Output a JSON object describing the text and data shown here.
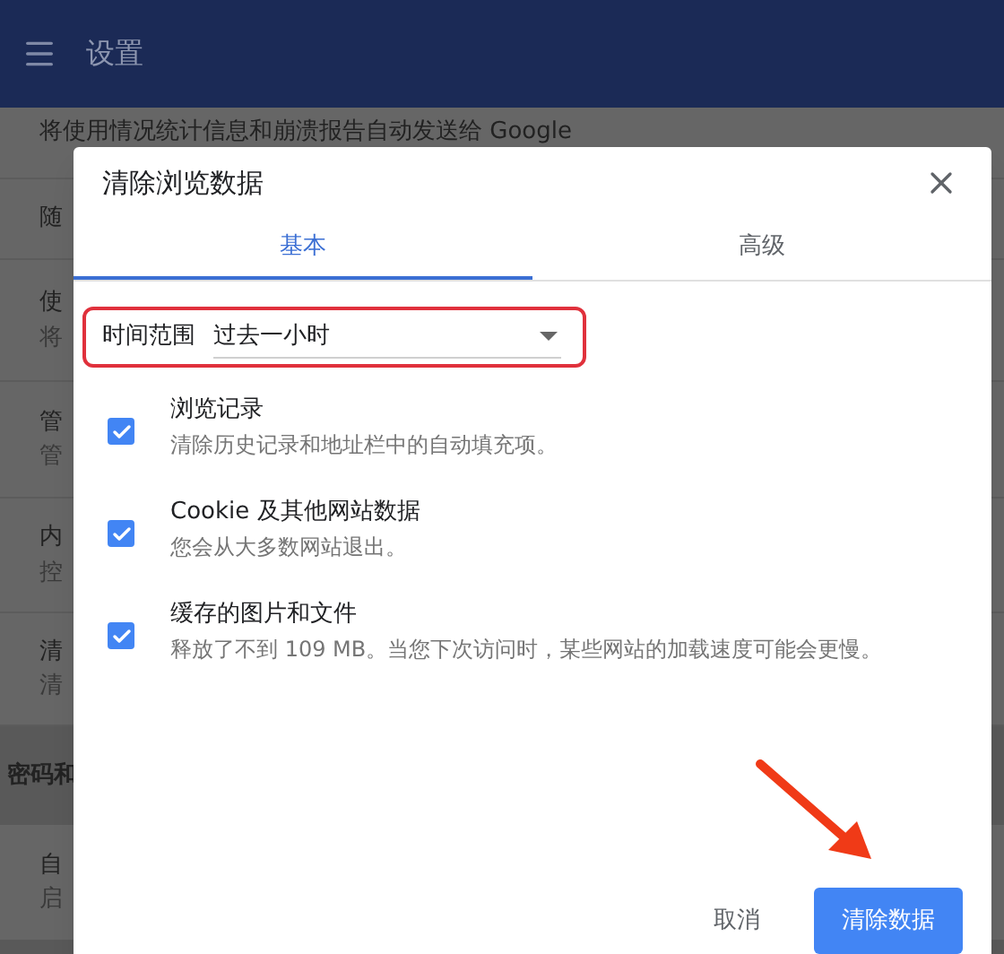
{
  "header": {
    "title": "设置"
  },
  "background": {
    "rows": [
      {
        "title": "将使用情况统计信息和崩溃报告自动发送给 Google"
      },
      {
        "title": "随"
      },
      {
        "title": "使",
        "subtitle": "将"
      },
      {
        "title": "管",
        "subtitle": "管"
      },
      {
        "title": "内",
        "subtitle": "控"
      },
      {
        "title": "清",
        "subtitle": "清"
      }
    ],
    "section_heading": "密码和",
    "rows2": [
      {
        "title": "自",
        "subtitle": "启"
      }
    ]
  },
  "dialog": {
    "title": "清除浏览数据",
    "tabs": [
      {
        "label": "基本",
        "selected": true
      },
      {
        "label": "高级",
        "selected": false
      }
    ],
    "time_range": {
      "label": "时间范围",
      "value": "过去一小时"
    },
    "options": [
      {
        "title": "浏览记录",
        "description": "清除历史记录和地址栏中的自动填充项。",
        "checked": true
      },
      {
        "title": "Cookie 及其他网站数据",
        "description": "您会从大多数网站退出。",
        "checked": true
      },
      {
        "title": "缓存的图片和文件",
        "description": "释放了不到 109 MB。当您下次访问时，某些网站的加载速度可能会更慢。",
        "checked": true
      }
    ],
    "buttons": {
      "cancel": "取消",
      "confirm": "清除数据"
    }
  }
}
